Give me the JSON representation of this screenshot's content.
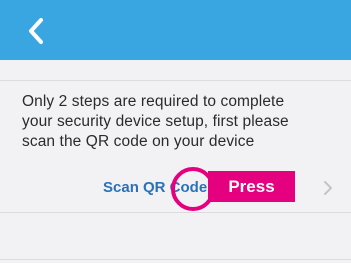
{
  "header": {
    "back_icon": "chevron-left-icon",
    "background_color": "#3aa6e1"
  },
  "content": {
    "instruction_line1": "Only 2 steps are required to complete",
    "instruction_line2": "your security device setup, first please",
    "instruction_line3": "scan the QR code on your device"
  },
  "scan_row": {
    "label": "Scan QR Code",
    "badge_label": "Press",
    "badge_color": "#e4007f",
    "chevron_icon": "chevron-right-icon"
  },
  "colors": {
    "link": "#2a72b8",
    "highlight": "#e4007f",
    "background": "#f2f2f4"
  }
}
